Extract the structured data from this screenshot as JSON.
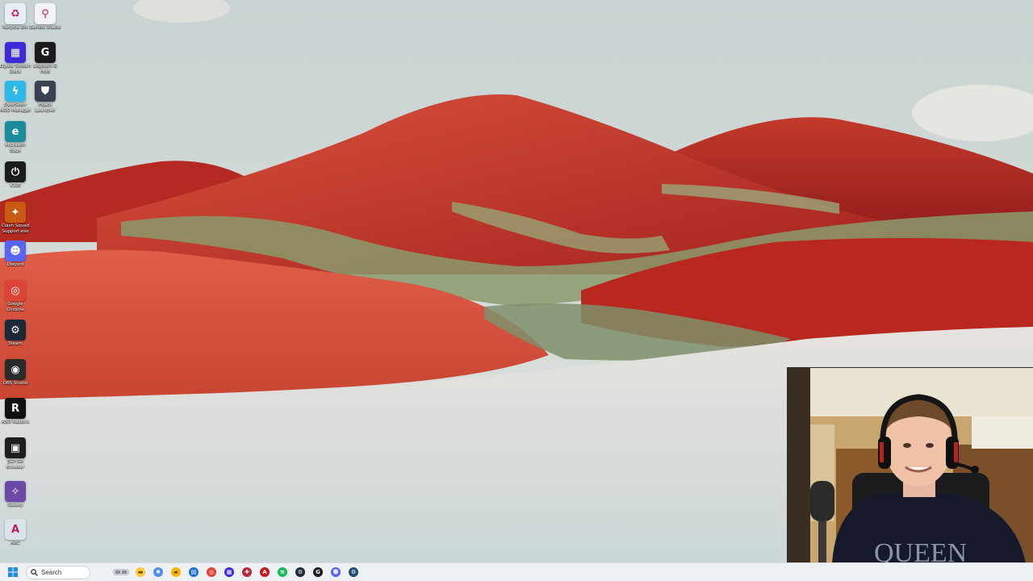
{
  "desktop": {
    "icons": [
      {
        "label": "Recycle Bin",
        "icon": "recycle-bin-icon",
        "color": "#e8eef6",
        "glyph": "♻"
      },
      {
        "label": "Bambu Studio",
        "icon": "location-pin-icon",
        "color": "#f3f3f3",
        "glyph": "⚲"
      },
      {
        "label": "Elgato Stream Deck",
        "icon": "stream-deck-icon",
        "color": "#3f2bd6",
        "glyph": "▦"
      },
      {
        "label": "Logitech G HUB",
        "icon": "logitech-g-icon",
        "color": "#1b1b1b",
        "glyph": "G"
      },
      {
        "label": "OverSeerr MOD Manager",
        "icon": "overwolf-icon",
        "color": "#2fb9e6",
        "glyph": "ϟ"
      },
      {
        "label": "Hijack Launcher",
        "icon": "shield-icon",
        "color": "#3a4150",
        "glyph": "⛊"
      },
      {
        "label": "Microsoft Edge",
        "icon": "edge-icon",
        "color": "#1a8c9e",
        "glyph": "e"
      },
      {
        "label": "iCUE",
        "icon": "icue-icon",
        "color": "#1c1c1c",
        "glyph": "⏻"
      },
      {
        "label": "Clash Squad Support.exe",
        "icon": "clash-squad-icon",
        "color": "#c85a12",
        "glyph": "✦"
      },
      {
        "label": "Discord",
        "icon": "discord-icon",
        "color": "#5865f2",
        "glyph": "☻"
      },
      {
        "label": "Google Chrome",
        "icon": "chrome-icon",
        "color": "#db4437",
        "glyph": "◎"
      },
      {
        "label": "Steam",
        "icon": "steam-icon",
        "color": "#1b2838",
        "glyph": "⚙"
      },
      {
        "label": "OBS Studio",
        "icon": "obs-icon",
        "color": "#2a2a2a",
        "glyph": "◉"
      },
      {
        "label": "ASO Raiders",
        "icon": "raiders-icon",
        "color": "#101010",
        "glyph": "R"
      },
      {
        "label": "SCP:SR Browser",
        "icon": "scp-icon",
        "color": "#1e1e1e",
        "glyph": "▣"
      },
      {
        "label": "Galaxy",
        "icon": "galaxy-icon",
        "color": "#6d4aa8",
        "glyph": "✧"
      },
      {
        "label": "ARC",
        "icon": "arc-icon",
        "color": "#d9e3ea",
        "glyph": "A"
      }
    ]
  },
  "taskbar": {
    "search_placeholder": "Search",
    "apps": [
      {
        "name": "file-explorer-icon",
        "color": "#ffc83d",
        "glyph": "▬"
      },
      {
        "name": "copilot-icon",
        "color": "#4f8fef",
        "glyph": "✸"
      },
      {
        "name": "folder-icon",
        "color": "#f4b400",
        "glyph": "▰"
      },
      {
        "name": "store-icon",
        "color": "#1f6fd6",
        "glyph": "▤"
      },
      {
        "name": "chrome-icon",
        "color": "#db4437",
        "glyph": "◎"
      },
      {
        "name": "stream-deck-icon",
        "color": "#3f2bd6",
        "glyph": "▦"
      },
      {
        "name": "app-red-icon",
        "color": "#b8283b",
        "glyph": "✚"
      },
      {
        "name": "adobe-icon",
        "color": "#c4161c",
        "glyph": "A"
      },
      {
        "name": "spotify-icon",
        "color": "#1db954",
        "glyph": "≋"
      },
      {
        "name": "steam-icon",
        "color": "#1b2838",
        "glyph": "⚙"
      },
      {
        "name": "logitech-g-icon",
        "color": "#1b1b1b",
        "glyph": "G"
      },
      {
        "name": "discord-icon",
        "color": "#5865f2",
        "glyph": "☻"
      },
      {
        "name": "steam-alt-icon",
        "color": "#244a72",
        "glyph": "⚙"
      }
    ]
  },
  "webcam": {
    "shirt_text": "QUEEN"
  }
}
